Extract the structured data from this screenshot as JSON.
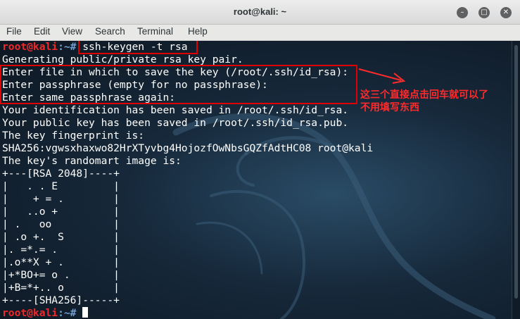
{
  "window": {
    "title": "root@kali: ~",
    "buttons": [
      "–",
      "□",
      "✕"
    ]
  },
  "menu": [
    "File",
    "Edit",
    "View",
    "Search",
    "Terminal",
    "Help"
  ],
  "prompt": {
    "user": "root@kali",
    "path": ":~#",
    "command": " ssh-keygen -t rsa"
  },
  "output": [
    "Generating public/private rsa key pair.",
    "Enter file in which to save the key (/root/.ssh/id_rsa):",
    "Enter passphrase (empty for no passphrase):",
    "Enter same passphrase again:",
    "Your identification has been saved in /root/.ssh/id_rsa.",
    "Your public key has been saved in /root/.ssh/id_rsa.pub.",
    "The key fingerprint is:",
    "SHA256:vgwsxhaxwo82HrXTyvbg4HojozfOwNbsGQZfAdtHC08 root@kali",
    "The key's randomart image is:",
    "+---[RSA 2048]----+",
    "|   . . E         |",
    "|    + = .        |",
    "|   ..o +         |",
    "| .   oo          |",
    "| .o +.  S        |",
    "|. =*.= .         |",
    "|.o**X + .        |",
    "|+*BO+= o .       |",
    "|+B=*+.. o        |",
    "+----[SHA256]-----+"
  ],
  "final_prompt": {
    "user": "root@kali",
    "path": ":~#"
  },
  "annotation": {
    "line1": "这三个直接点击回车就可以了",
    "line2": "不用填写东西",
    "color": "#ff2b2b"
  },
  "colors": {
    "prompt_user": "#ef2929",
    "prompt_path": "#729fcf",
    "highlight_box": "#e00000"
  }
}
